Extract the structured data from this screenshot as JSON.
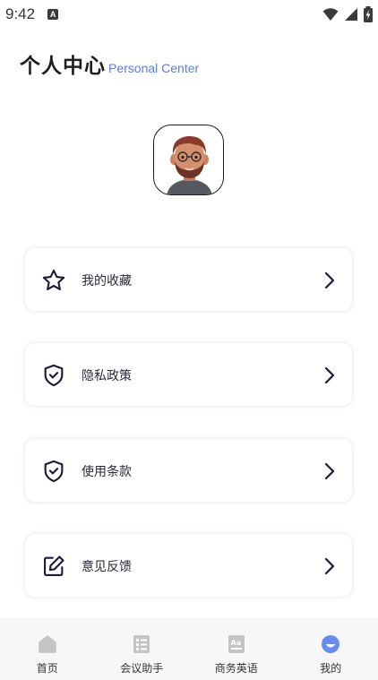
{
  "status_bar": {
    "time": "9:42",
    "notification_icon": "a-icon",
    "wifi_icon": "wifi-icon",
    "signal_icon": "signal-icon",
    "battery_icon": "battery-charging-icon"
  },
  "header": {
    "title": "个人中心",
    "subtitle": "Personal Center"
  },
  "avatar": {
    "icon": "avatar-memoji"
  },
  "menu": {
    "items": [
      {
        "label": "我的收藏",
        "icon": "star-icon"
      },
      {
        "label": "隐私政策",
        "icon": "shield-check-icon"
      },
      {
        "label": "使用条款",
        "icon": "shield-check-icon"
      },
      {
        "label": "意见反馈",
        "icon": "edit-icon"
      }
    ]
  },
  "bottom_nav": {
    "items": [
      {
        "label": "首页",
        "icon": "home-icon",
        "active": false
      },
      {
        "label": "会议助手",
        "icon": "list-icon",
        "active": false
      },
      {
        "label": "商务英语",
        "icon": "translate-icon",
        "active": false
      },
      {
        "label": "我的",
        "icon": "profile-icon",
        "active": true
      }
    ]
  },
  "colors": {
    "accent": "#5b7fe0",
    "icon_dark": "#1a1a3a",
    "nav_inactive": "#c4c4c4",
    "nav_active": "#6a8cef"
  }
}
